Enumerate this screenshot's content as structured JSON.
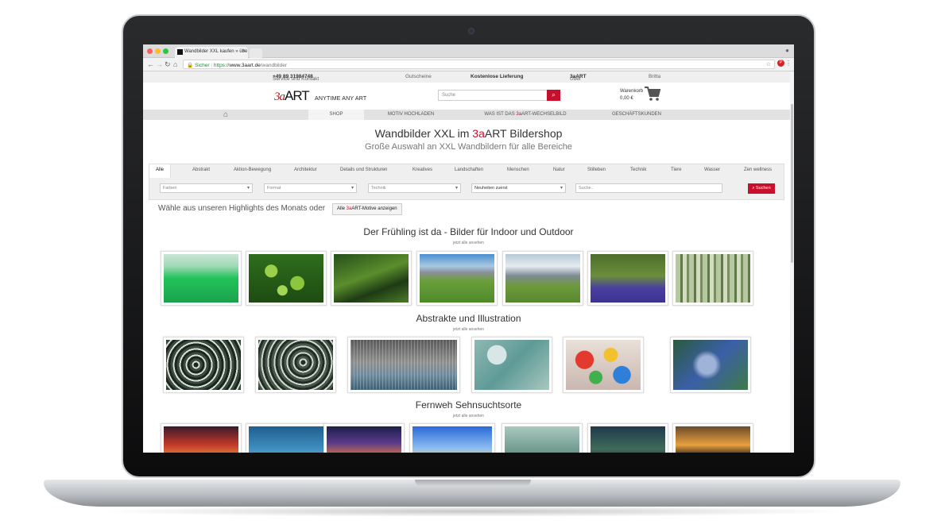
{
  "browser": {
    "tab_title": "Wandbilder XXL kaufen » übe",
    "secure_label": "Sicher",
    "url_scheme": "https://",
    "url_host": "www.3aart.de",
    "url_path": "/wandbilder"
  },
  "topbar": {
    "service_label": "Service und Kontakt",
    "phone": "+49 89 31984748",
    "vouchers": "Gutscheine",
    "free_delivery": "Kostenlose Lieferung",
    "about_prefix": "Über",
    "about_brand_accent": "3a",
    "about_brand_rest": "ART",
    "user": "Britta"
  },
  "header": {
    "logo_mark": "3a",
    "logo_text": "ART",
    "logo_tagline": "ANYTIME ANY ART",
    "search_placeholder": "Suche",
    "cart_label": "Warenkorb",
    "cart_total": "0,00 €"
  },
  "mainnav": {
    "items": [
      "SHOP",
      "MOTIV HOCHLADEN",
      "WAS IST DAS ",
      "3a",
      "ART-WECHSELBILD",
      "GESCHÄFTSKUNDEN"
    ]
  },
  "hero": {
    "title_prefix": "Wandbilder XXL im ",
    "title_accent": "3a",
    "title_suffix": "ART Bildershop",
    "subtitle": "Große Auswahl an XXL Wandbildern für alle Bereiche"
  },
  "categories": [
    "Alle",
    "Abstrakt",
    "Aktion-Bewegung",
    "Architektur",
    "Details und Strukturen",
    "Kreatives",
    "Landschaften",
    "Menschen",
    "Natur",
    "Stilleben",
    "Technik",
    "Tiere",
    "Wasser",
    "Zen wellness"
  ],
  "filters": {
    "farben": "Farben",
    "format": "Format",
    "technik": "Technik",
    "sort": "Neuheiten zuerst",
    "search_placeholder": "Suche..",
    "button": "Suchen"
  },
  "highlights": {
    "text": "Wähle aus unseren Highlights des Monats oder",
    "button_prefix": "Alle ",
    "button_accent": "3a",
    "button_suffix": "ART-Motive anzeigen"
  },
  "sections": [
    {
      "title": "Der Frühling ist da - Bilder für Indoor und Outdoor",
      "link": "jetzt alle ansehen"
    },
    {
      "title": "Abstrakte und Illustration",
      "link": "jetzt alle ansehen"
    },
    {
      "title": "Fernweh Sehnsuchtsorte",
      "link": "jetzt alle ansehen"
    }
  ],
  "colors": {
    "accent": "#c8102e",
    "topbar_bg": "#efefef",
    "nav_bg": "#e2e2e2"
  }
}
